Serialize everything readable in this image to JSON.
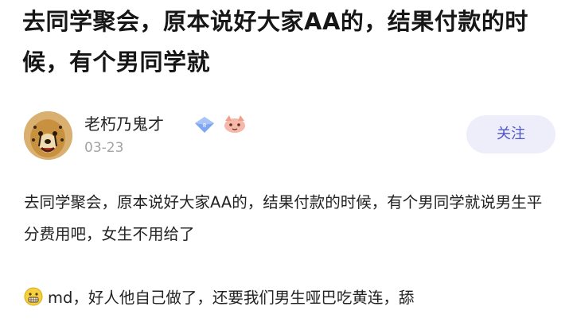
{
  "post": {
    "title": "去同学聚会，原本说好大家AA的，结果付款的时候，有个男同学就",
    "author": {
      "name": "老朽乃鬼才",
      "date": "03-23",
      "badges": [
        "blue-diamond-icon",
        "cat-face-icon"
      ]
    },
    "follow_label": "关注",
    "paragraph_1": "去同学聚会，原本说好大家AA的，结果付款的时候，有个男同学就说男生平分费用吧，女生不用给了",
    "paragraph_2_emoji": "grimacing-emoji-icon",
    "paragraph_2": "md，好人他自己做了，还要我们男生哑巴吃黄连，舔"
  },
  "colors": {
    "follow_bg": "#eeeefb",
    "follow_text": "#4e55c8",
    "date_text": "#a3a3a3"
  }
}
